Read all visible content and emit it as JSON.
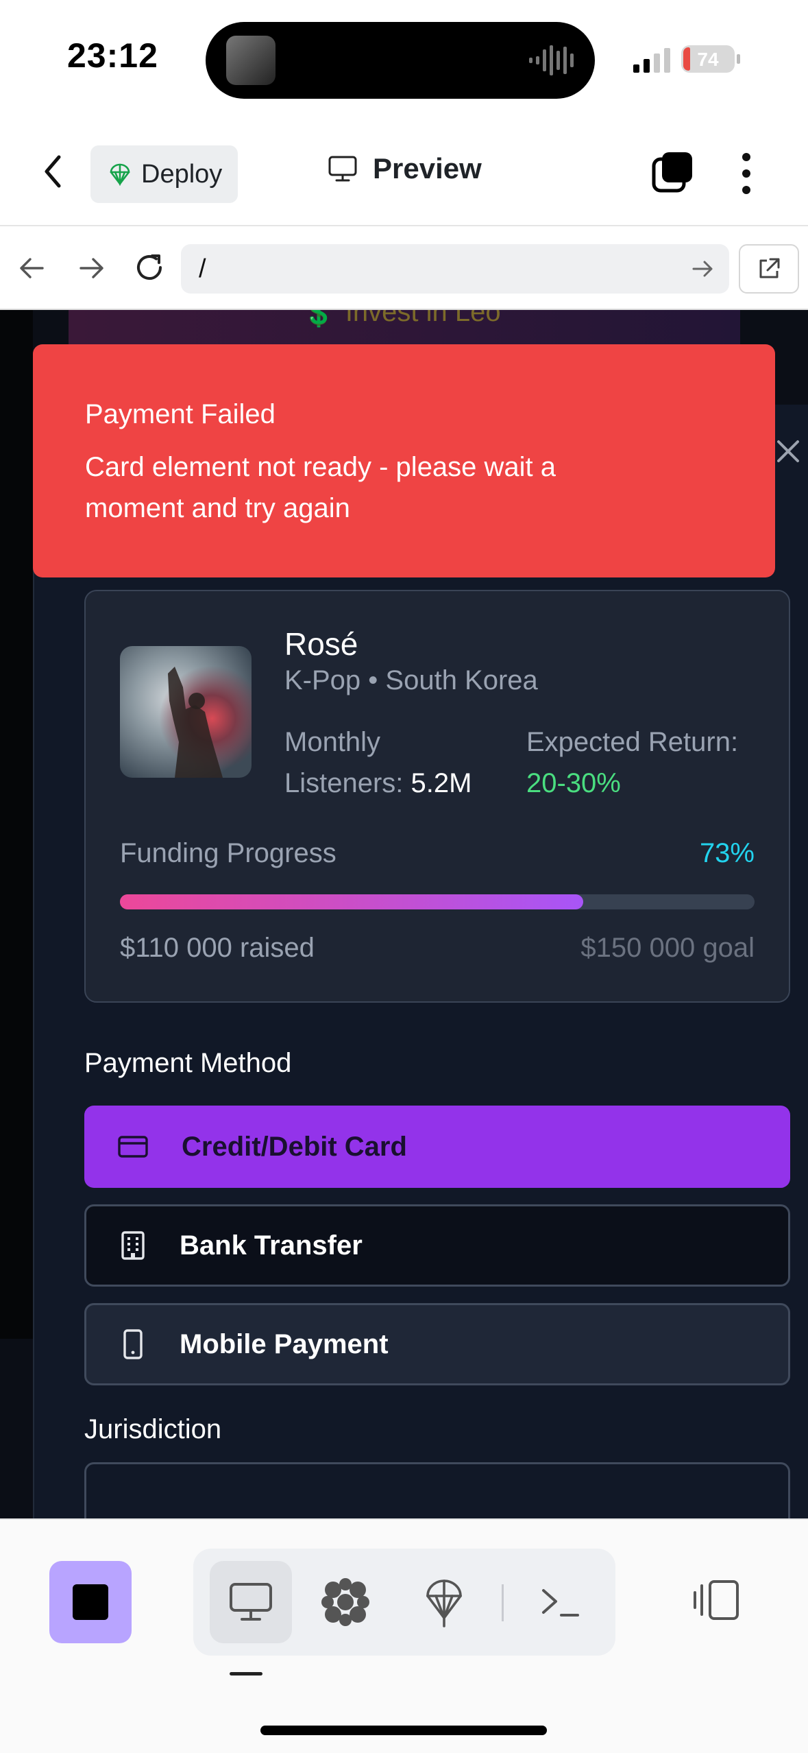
{
  "status_bar": {
    "time": "23:12",
    "battery": "74"
  },
  "app_toolbar": {
    "deploy_label": "Deploy",
    "preview_label": "Preview"
  },
  "url_bar": {
    "url": "/"
  },
  "background": {
    "invest_label": "Invest in Leo"
  },
  "toast": {
    "title": "Payment Failed",
    "message": "Card element not ready - please wait a moment and try again",
    "color": "#ef4444"
  },
  "artist": {
    "name": "Rosé",
    "genre_country": "K-Pop • South Korea",
    "listeners_label": "Monthly Listeners: ",
    "listeners_value": "5.2M",
    "return_label": "Expected Return: ",
    "return_value": "20-30%"
  },
  "funding": {
    "label": "Funding Progress",
    "percent_text": "73%",
    "progress": 0.73,
    "raised": "$110 000 raised",
    "goal": "$150 000 goal"
  },
  "payment": {
    "title": "Payment Method",
    "methods": [
      {
        "label": "Credit/Debit Card",
        "icon": "credit-card-icon",
        "selected": true
      },
      {
        "label": "Bank Transfer",
        "icon": "building-icon",
        "selected": false
      },
      {
        "label": "Mobile Payment",
        "icon": "smartphone-icon",
        "selected": false
      }
    ],
    "accent": "#9333ea"
  },
  "jurisdiction": {
    "title": "Jurisdiction"
  }
}
